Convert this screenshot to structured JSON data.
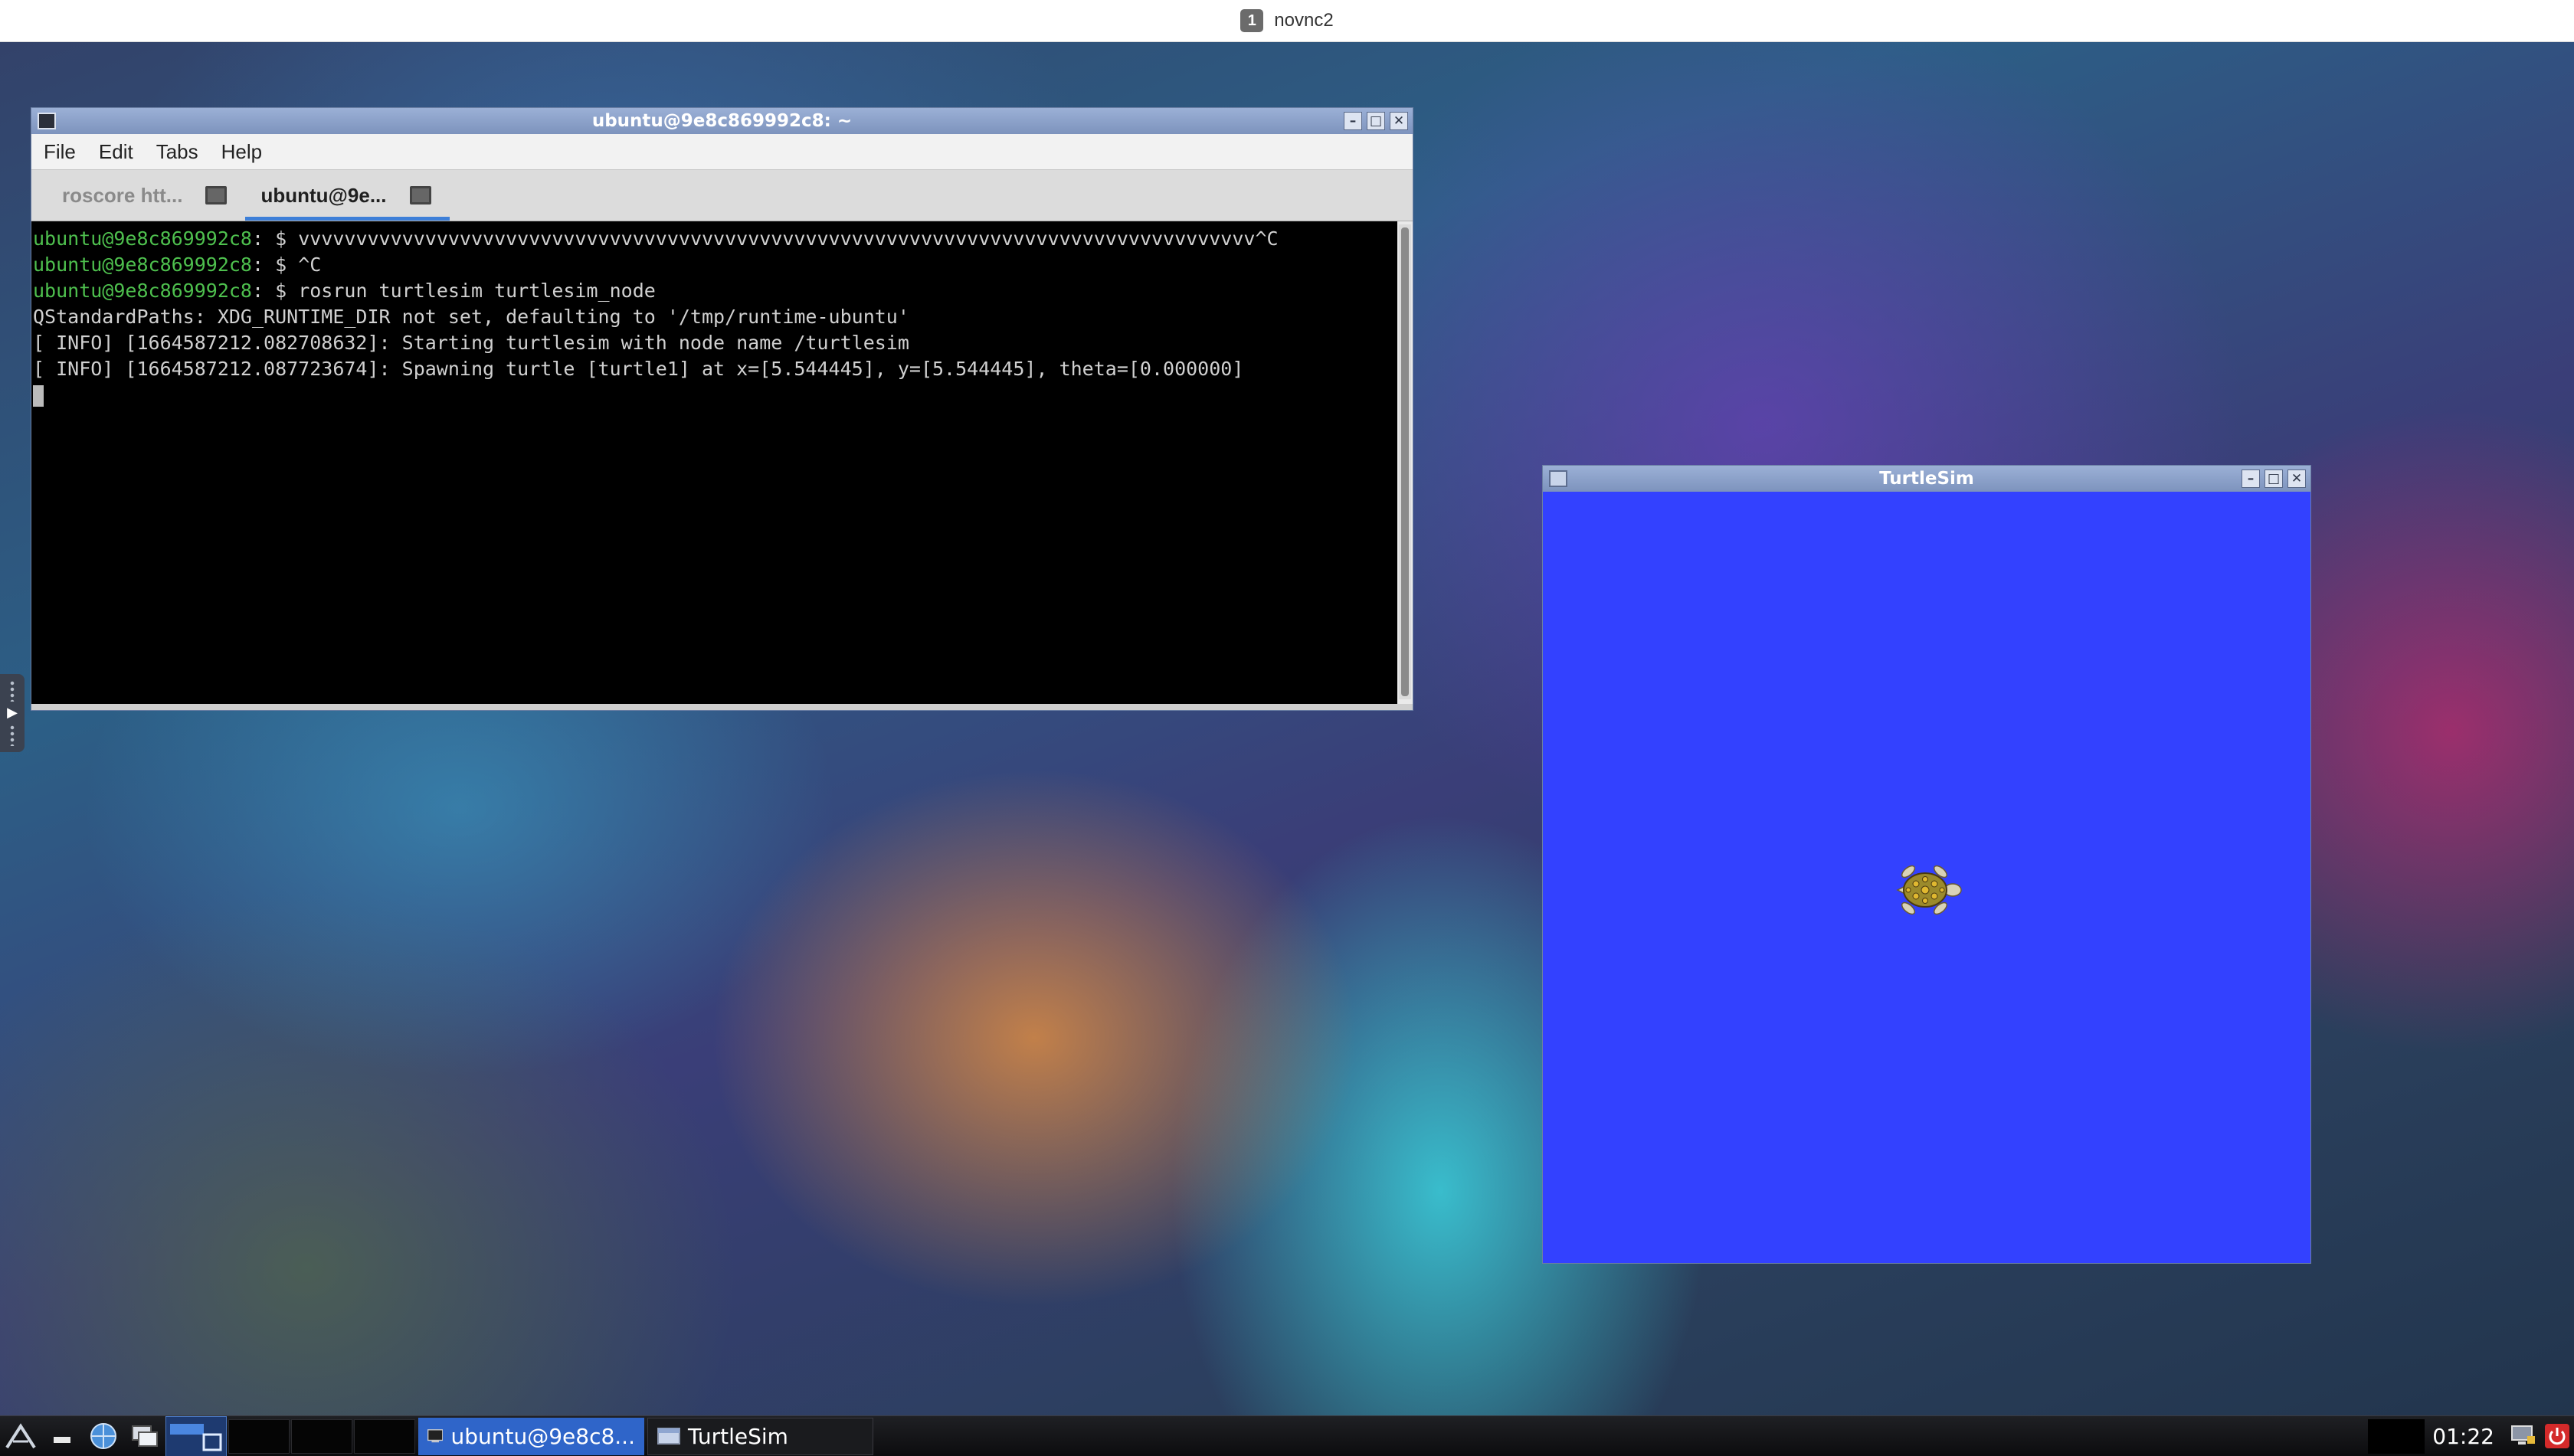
{
  "browser_bar": {
    "badge": "1",
    "title": "novnc2"
  },
  "terminal": {
    "title": "ubuntu@9e8c869992c8: ~",
    "menu": [
      "File",
      "Edit",
      "Tabs",
      "Help"
    ],
    "tabs": [
      {
        "label": "roscore htt...",
        "active": false
      },
      {
        "label": "ubuntu@9e...",
        "active": true
      }
    ],
    "lines": [
      {
        "prompt": "ubuntu@9e8c869992c8",
        "sep": ": $ ",
        "text": "vvvvvvvvvvvvvvvvvvvvvvvvvvvvvvvvvvvvvvvvvvvvvvvvvvvvvvvvvvvvvvvvvvvvvvvvvvvvvvvvvvv^C"
      },
      {
        "prompt": "ubuntu@9e8c869992c8",
        "sep": ": $ ",
        "text": "^C"
      },
      {
        "prompt": "ubuntu@9e8c869992c8",
        "sep": ": $ ",
        "text": "rosrun turtlesim turtlesim_node"
      },
      {
        "prompt": "",
        "sep": "",
        "text": "QStandardPaths: XDG_RUNTIME_DIR not set, defaulting to '/tmp/runtime-ubuntu'"
      },
      {
        "prompt": "",
        "sep": "",
        "text": "[ INFO] [1664587212.082708632]: Starting turtlesim with node name /turtlesim"
      },
      {
        "prompt": "",
        "sep": "",
        "text": "[ INFO] [1664587212.087723674]: Spawning turtle [turtle1] at x=[5.544445], y=[5.544445], theta=[0.000000]"
      }
    ]
  },
  "turtlesim": {
    "title": "TurtleSim",
    "background_color": "#3341ff"
  },
  "taskbar": {
    "tasks": [
      {
        "label": "ubuntu@9e8c8...",
        "icon": "terminal-icon",
        "active": true
      },
      {
        "label": "TurtleSim",
        "icon": "window-icon",
        "active": false
      }
    ],
    "clock": "01:22"
  },
  "window_buttons": {
    "minimize": "–",
    "maximize": "□",
    "close": "✕"
  }
}
